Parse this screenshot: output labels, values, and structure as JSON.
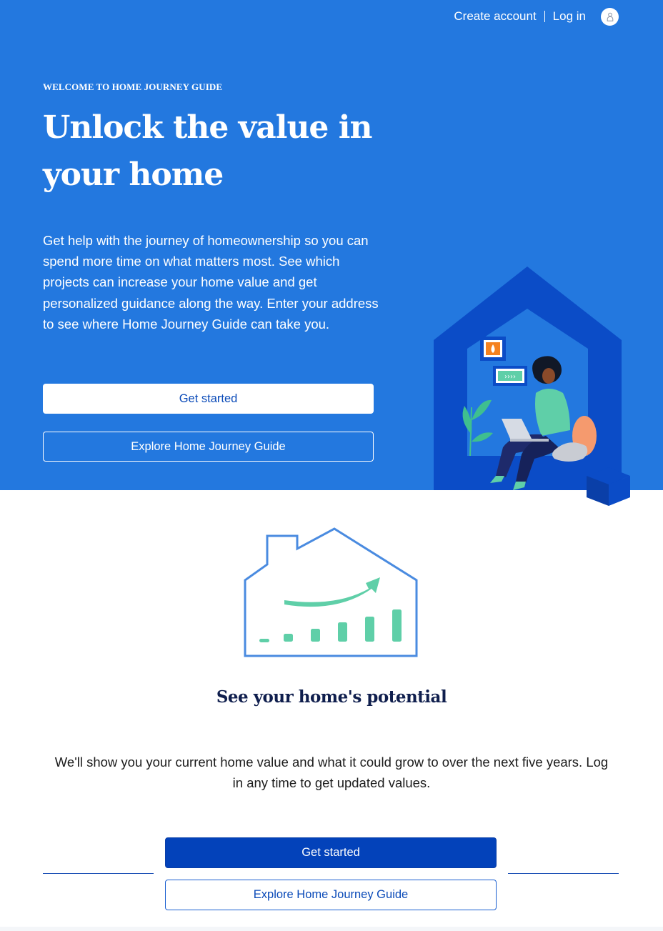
{
  "colors": {
    "hero_background": "#2378df",
    "primary_button": "#0342ba",
    "heading_navy": "#0f1e4d",
    "chart_green": "#5fcfa8",
    "house_outline": "#4a8be0"
  },
  "topnav": {
    "create_account": "Create account",
    "log_in": "Log in",
    "avatar_icon": "person-icon"
  },
  "hero": {
    "eyebrow": "WELCOME TO HOME JOURNEY GUIDE",
    "title": "Unlock the value in your home",
    "body": "Get help with the journey of homeownership so you can spend more time on what matters most. See which projects can increase your home value and get personalized guidance along the way. Enter your address to see where Home Journey Guide can take you.",
    "primary_button": "Get started",
    "secondary_button": "Explore Home Journey Guide"
  },
  "potential": {
    "title": "See your home's potential",
    "body": "We'll show you your current home value and what it could grow to over the next five years. Log in any time to get updated values.",
    "primary_button": "Get started",
    "secondary_button": "Explore Home Journey Guide"
  }
}
